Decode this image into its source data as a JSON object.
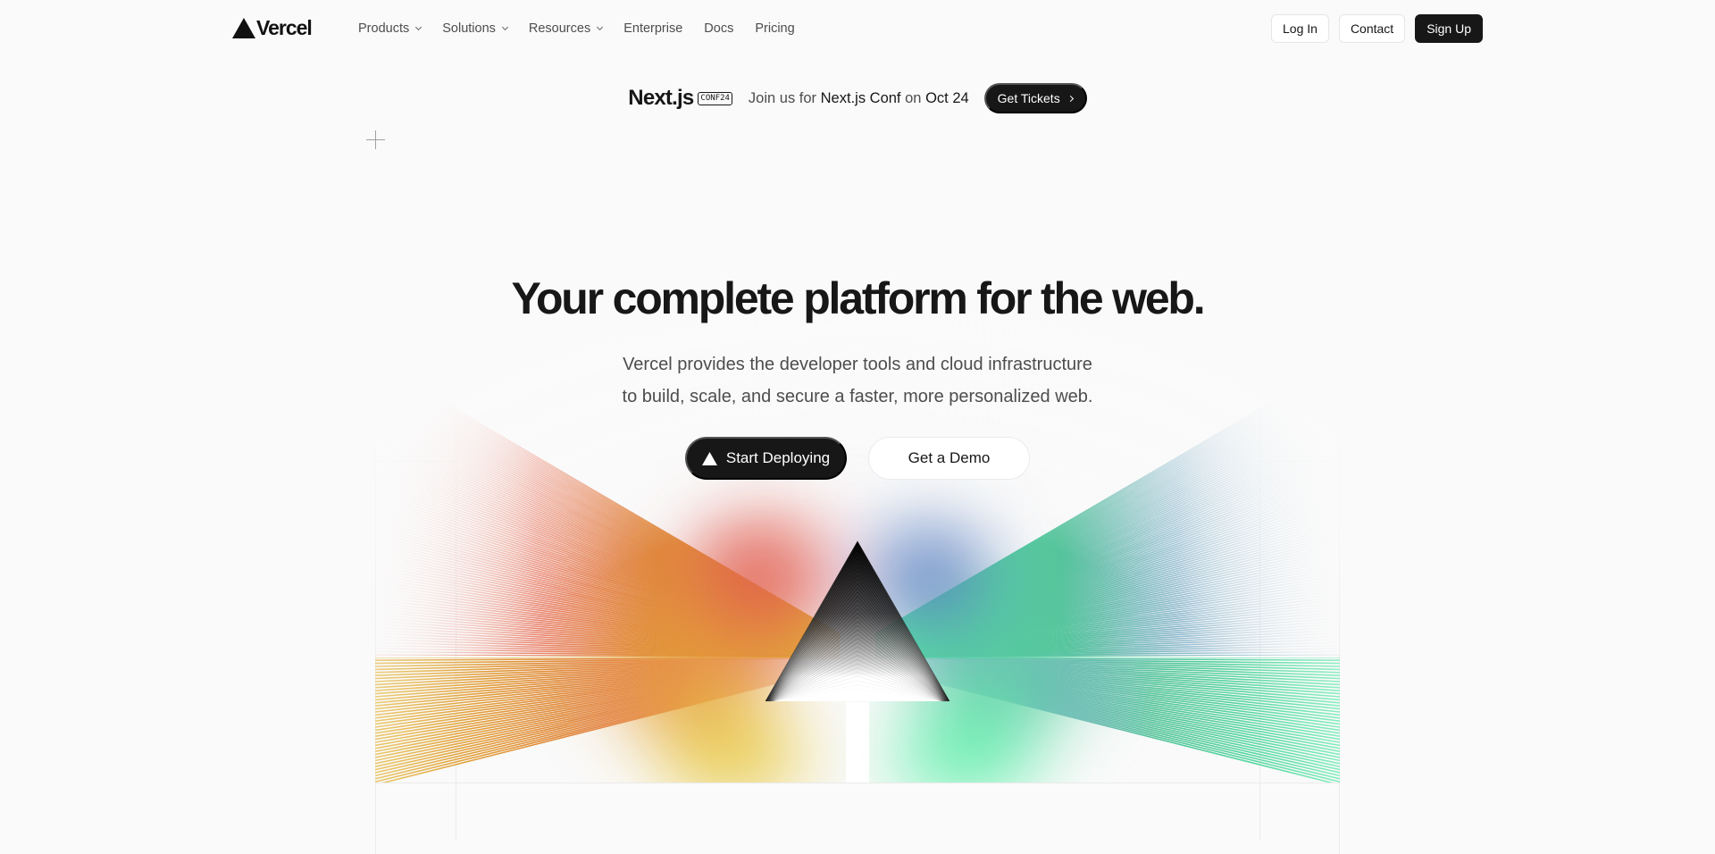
{
  "brand": {
    "name": "Vercel",
    "logo_icon": "triangle-logo-icon"
  },
  "nav": {
    "items": [
      {
        "label": "Products",
        "has_dropdown": true
      },
      {
        "label": "Solutions",
        "has_dropdown": true
      },
      {
        "label": "Resources",
        "has_dropdown": true
      },
      {
        "label": "Enterprise",
        "has_dropdown": false
      },
      {
        "label": "Docs",
        "has_dropdown": false
      },
      {
        "label": "Pricing",
        "has_dropdown": false
      }
    ],
    "login_label": "Log In",
    "contact_label": "Contact",
    "signup_label": "Sign Up"
  },
  "banner": {
    "product": "Next.js",
    "badge": "CONF24",
    "text_prefix": "Join us for",
    "event": "Next.js Conf",
    "text_mid": "on",
    "date": "Oct 24",
    "cta_label": "Get Tickets"
  },
  "hero": {
    "title": "Your complete platform for the web.",
    "subtitle_line1": "Vercel provides the developer tools and cloud infrastructure",
    "subtitle_line2": "to build, scale, and secure a faster, more personalized web.",
    "primary_cta": "Start Deploying",
    "secondary_cta": "Get a Demo"
  },
  "colors": {
    "background": "#fafafa",
    "text": "#171717",
    "muted": "#4d4d4d",
    "grid_line": "#ebebeb",
    "spectrum": [
      "#e2725b",
      "#e07b3c",
      "#e5b53a",
      "#5fa0d8",
      "#5ad9a4",
      "#59f0a8"
    ]
  }
}
